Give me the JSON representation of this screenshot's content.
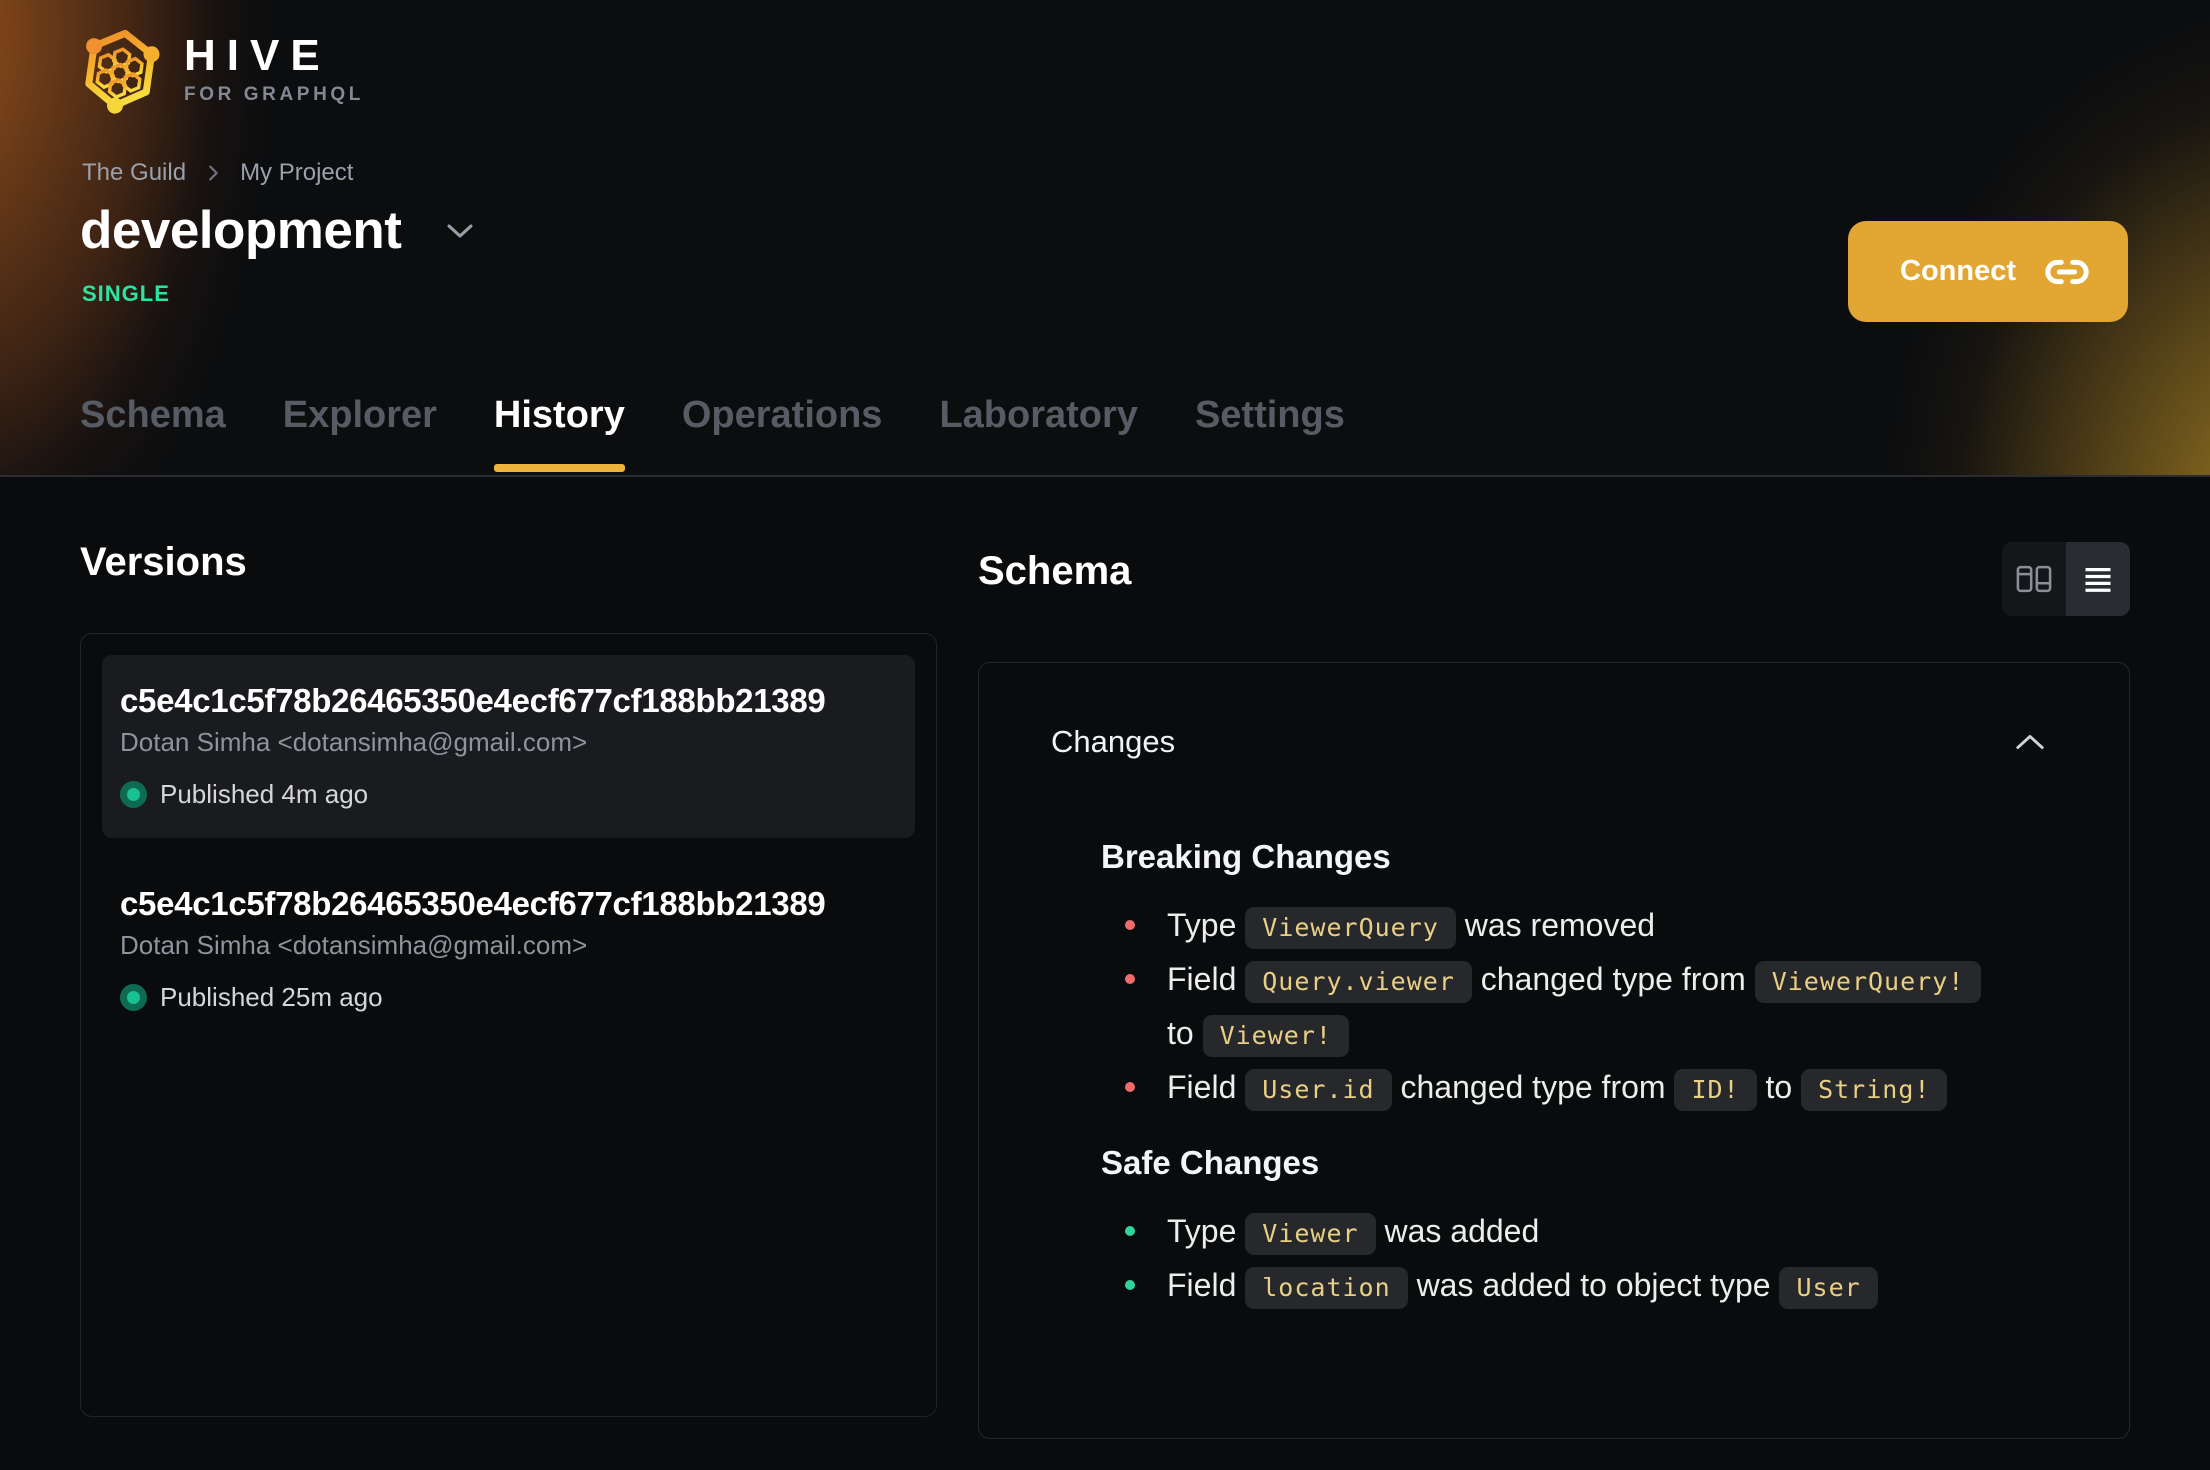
{
  "brand": {
    "name": "HIVE",
    "tagline": "FOR GRAPHQL"
  },
  "breadcrumb": {
    "items": [
      "The Guild",
      "My Project"
    ]
  },
  "target": {
    "name": "development",
    "badge": "SINGLE"
  },
  "connect": {
    "label": "Connect"
  },
  "tabs": [
    {
      "label": "Schema",
      "active": false
    },
    {
      "label": "Explorer",
      "active": false
    },
    {
      "label": "History",
      "active": true
    },
    {
      "label": "Operations",
      "active": false
    },
    {
      "label": "Laboratory",
      "active": false
    },
    {
      "label": "Settings",
      "active": false
    }
  ],
  "versions": {
    "title": "Versions",
    "items": [
      {
        "hash": "c5e4c1c5f78b26465350e4ecf677cf188bb21389",
        "author": "Dotan Simha <dotansimha@gmail.com>",
        "status": "Published 4m ago",
        "selected": true
      },
      {
        "hash": "c5e4c1c5f78b26465350e4ecf677cf188bb21389",
        "author": "Dotan Simha <dotansimha@gmail.com>",
        "status": "Published 25m ago",
        "selected": false
      }
    ]
  },
  "schema": {
    "title": "Schema",
    "view_toggle": {
      "options": [
        "columns-view",
        "list-view"
      ],
      "selected": "list-view"
    },
    "changes": {
      "title": "Changes",
      "sections": [
        {
          "title": "Breaking Changes",
          "severity": "breaking",
          "items": [
            {
              "segments": [
                {
                  "text": "Type "
                },
                {
                  "code": "ViewerQuery"
                },
                {
                  "text": " was removed"
                }
              ]
            },
            {
              "segments": [
                {
                  "text": "Field "
                },
                {
                  "code": "Query.viewer"
                },
                {
                  "text": " changed type from "
                },
                {
                  "code": "ViewerQuery!"
                },
                {
                  "break": true
                },
                {
                  "text": "to "
                },
                {
                  "code": "Viewer!"
                }
              ]
            },
            {
              "segments": [
                {
                  "text": "Field "
                },
                {
                  "code": "User.id"
                },
                {
                  "text": " changed type from "
                },
                {
                  "code": "ID!"
                },
                {
                  "text": " to "
                },
                {
                  "code": "String!"
                }
              ]
            }
          ]
        },
        {
          "title": "Safe Changes",
          "severity": "safe",
          "items": [
            {
              "segments": [
                {
                  "text": "Type "
                },
                {
                  "code": "Viewer"
                },
                {
                  "text": " was added"
                }
              ]
            },
            {
              "segments": [
                {
                  "text": "Field "
                },
                {
                  "code": "location"
                },
                {
                  "text": " was added to object type "
                },
                {
                  "code": "User"
                }
              ]
            }
          ]
        }
      ]
    }
  },
  "colors": {
    "accent": "#e2a733",
    "tab_underline": "#edb43c",
    "badge_green": "#2de3a1",
    "published_dot": "#17c191",
    "breaking_red": "#ee6c6c",
    "safe_green": "#2fd49c",
    "code_text": "#e9cf85"
  }
}
